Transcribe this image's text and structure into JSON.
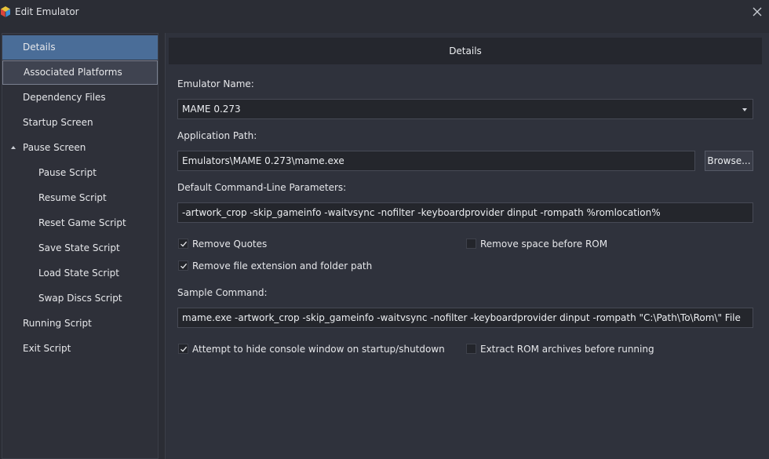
{
  "window": {
    "title": "Edit Emulator",
    "icon": "cube-app-icon",
    "close_icon": "close-icon"
  },
  "sidebar": {
    "items": [
      {
        "label": "Details",
        "state": "selected"
      },
      {
        "label": "Associated Platforms",
        "state": "hover"
      },
      {
        "label": "Dependency Files"
      },
      {
        "label": "Startup Screen"
      },
      {
        "label": "Pause Screen",
        "expanded": true
      },
      {
        "label": "Pause Script"
      },
      {
        "label": "Resume Script"
      },
      {
        "label": "Reset Game Script"
      },
      {
        "label": "Save State Script"
      },
      {
        "label": "Load State Script"
      },
      {
        "label": "Swap Discs Script"
      },
      {
        "label": "Running Script"
      },
      {
        "label": "Exit Script"
      }
    ]
  },
  "details": {
    "header": "Details",
    "emulator_name_label": "Emulator Name:",
    "emulator_name_value": "MAME 0.273",
    "app_path_label": "Application Path:",
    "app_path_value": "Emulators\\MAME 0.273\\mame.exe",
    "browse_label": "Browse...",
    "params_label": "Default Command-Line Parameters:",
    "params_value": "-artwork_crop -skip_gameinfo -waitvsync -nofilter -keyboardprovider dinput -rompath %romlocation%",
    "remove_quotes": {
      "label": "Remove Quotes",
      "checked": true
    },
    "remove_space": {
      "label": "Remove space before ROM",
      "checked": false
    },
    "remove_ext": {
      "label": "Remove file extension and folder path",
      "checked": true
    },
    "sample_label": "Sample Command:",
    "sample_value": "mame.exe -artwork_crop -skip_gameinfo -waitvsync -nofilter -keyboardprovider dinput -rompath \"C:\\Path\\To\\Rom\\\" File",
    "hide_console": {
      "label": "Attempt to hide console window on startup/shutdown",
      "checked": true
    },
    "extract_rom": {
      "label": "Extract ROM archives before running",
      "checked": false
    }
  },
  "colors": {
    "background": "#2b2d35",
    "selected": "#4a6d98",
    "field": "#24262c"
  }
}
